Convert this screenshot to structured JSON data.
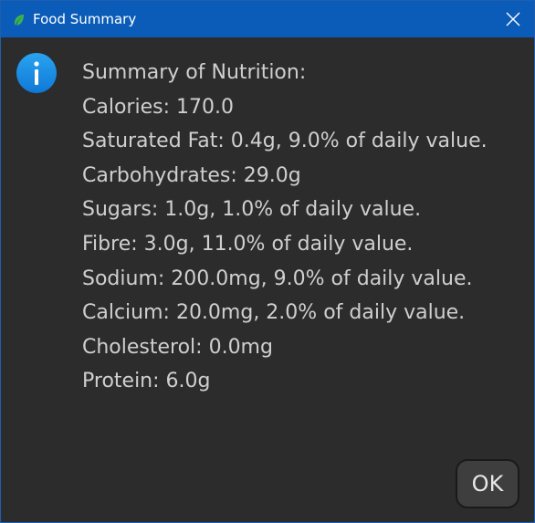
{
  "window": {
    "title": "Food Summary",
    "title_bar_color": "#0a5cb8",
    "app_icon": "leaf-icon",
    "close_icon": "close-icon"
  },
  "dialog": {
    "icon": "info-icon",
    "icon_color": "#1a8fe0",
    "lines": [
      "Summary of Nutrition:",
      "Calories: 170.0",
      "Saturated Fat: 0.4g, 9.0% of daily value.",
      "Carbohydrates: 29.0g",
      "Sugars: 1.0g, 1.0% of daily value.",
      "Fibre: 3.0g, 11.0% of daily value.",
      "Sodium: 200.0mg, 9.0% of daily value.",
      "Calcium: 20.0mg, 2.0% of daily value.",
      "Cholesterol: 0.0mg",
      "Protein: 6.0g"
    ],
    "ok_label": "OK"
  }
}
